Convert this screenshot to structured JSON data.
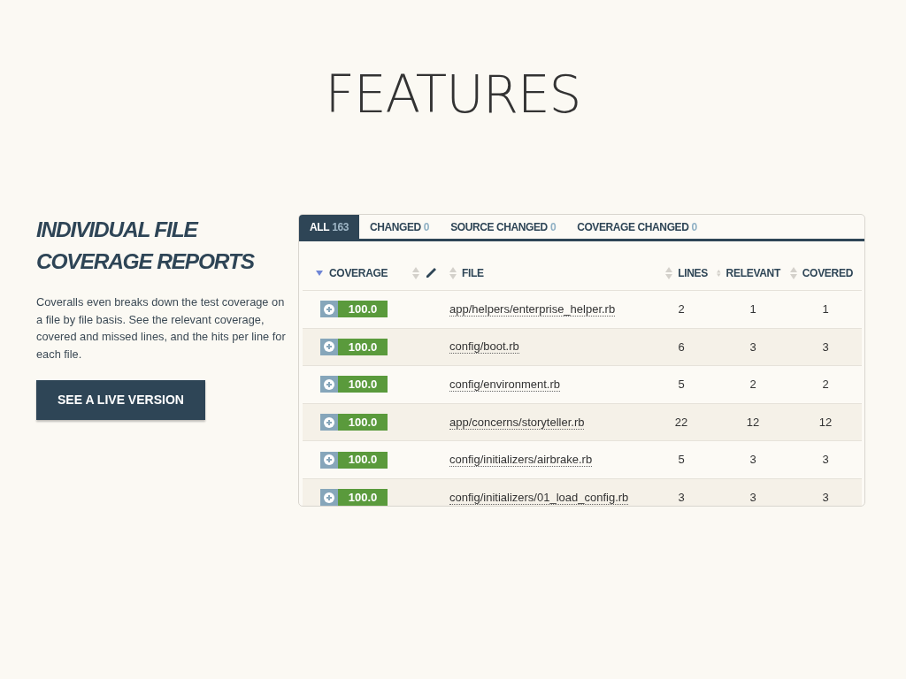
{
  "slide_title": "FEATURES",
  "feature": {
    "heading": "INDIVIDUAL FILE COVERAGE REPORTS",
    "description": "Coveralls even breaks down the test coverage on a file by file basis. See the relevant coverage, covered and missed lines, and the hits per line for each file.",
    "button": "SEE A LIVE VERSION"
  },
  "tabs": [
    {
      "label": "ALL",
      "count": "163",
      "selected": true
    },
    {
      "label": "CHANGED",
      "count": "0",
      "selected": false
    },
    {
      "label": "SOURCE CHANGED",
      "count": "0",
      "selected": false
    },
    {
      "label": "COVERAGE CHANGED",
      "count": "0",
      "selected": false
    }
  ],
  "table": {
    "columns": [
      {
        "kind": "coverage",
        "label": "COVERAGE",
        "sorted": true
      },
      {
        "kind": "edit",
        "sorted": false
      },
      {
        "kind": "file",
        "label": "FILE",
        "sorted": false
      },
      {
        "kind": "lines",
        "label": "LINES",
        "sorted": false
      },
      {
        "kind": "relevant",
        "label": "RELEVANT",
        "sorted": false
      },
      {
        "kind": "covered",
        "label": "COVERED",
        "sorted": false
      }
    ],
    "rows": [
      {
        "coverage": "100.0",
        "file": "app/helpers/enterprise_helper.rb",
        "lines": "2",
        "relevant": "1",
        "covered": "1"
      },
      {
        "coverage": "100.0",
        "file": "config/boot.rb",
        "lines": "6",
        "relevant": "3",
        "covered": "3"
      },
      {
        "coverage": "100.0",
        "file": "config/environment.rb",
        "lines": "5",
        "relevant": "2",
        "covered": "2"
      },
      {
        "coverage": "100.0",
        "file": "app/concerns/storyteller.rb",
        "lines": "22",
        "relevant": "12",
        "covered": "12"
      },
      {
        "coverage": "100.0",
        "file": "config/initializers/airbrake.rb",
        "lines": "5",
        "relevant": "3",
        "covered": "3"
      },
      {
        "coverage": "100.0",
        "file": "config/initializers/01_load_config.rb",
        "lines": "3",
        "relevant": "3",
        "covered": "3"
      }
    ]
  }
}
